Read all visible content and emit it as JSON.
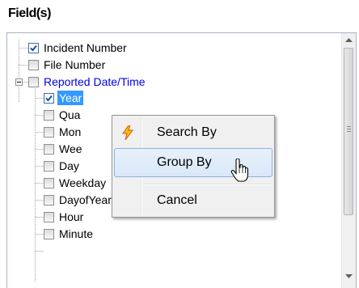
{
  "panel": {
    "title": "Field(s)"
  },
  "tree": {
    "items": [
      {
        "label": "Incident Number",
        "checked": true
      },
      {
        "label": "File Number",
        "checked": false
      },
      {
        "label": "Reported Date/Time",
        "checked": false,
        "expanded": true
      },
      {
        "label": "Year",
        "checked": true,
        "selected": true
      },
      {
        "label": "Qua",
        "checked": false
      },
      {
        "label": "Mon",
        "checked": false
      },
      {
        "label": "Wee",
        "checked": false
      },
      {
        "label": "Day",
        "checked": false
      },
      {
        "label": "Weekday",
        "checked": false
      },
      {
        "label": "DayofYear",
        "checked": false
      },
      {
        "label": "Hour",
        "checked": false
      },
      {
        "label": "Minute",
        "checked": false
      }
    ]
  },
  "context_menu": {
    "items": [
      {
        "label": "Search By",
        "icon": "lightning-icon"
      },
      {
        "label": "Group By",
        "hovered": true
      },
      {
        "label": "Cancel"
      }
    ]
  },
  "colors": {
    "selection": "#3399ff",
    "group_label": "#0000ee",
    "menu_background": "#f0f0f0",
    "menu_hover": "#d9e8f9"
  }
}
